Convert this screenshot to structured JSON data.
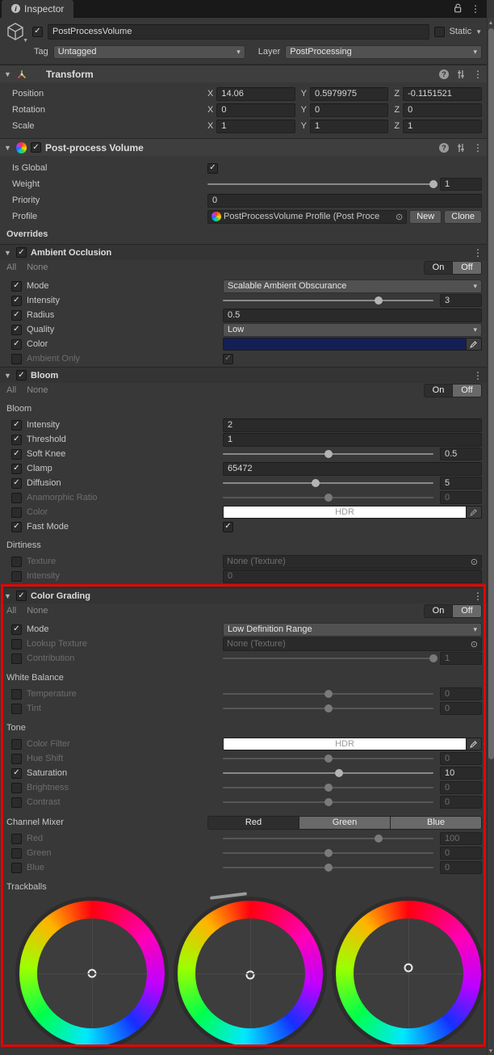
{
  "icons": {
    "check": "✓",
    "foldout": "▼",
    "caret": "▾",
    "kebab": "⋮",
    "help": "?",
    "picker": "⊙",
    "up": "▲",
    "down": "▼",
    "info": "i",
    "static_caret": "▼"
  },
  "colors": {
    "highlight": "#e60000",
    "ao_color_swatch": "#141f56"
  },
  "tab": {
    "title": "Inspector"
  },
  "gameobject": {
    "name": "PostProcessVolume",
    "static_label": "Static",
    "tag_label": "Tag",
    "tag_value": "Untagged",
    "layer_label": "Layer",
    "layer_value": "PostProcessing"
  },
  "transform": {
    "title": "Transform",
    "axis": {
      "x": "X",
      "y": "Y",
      "z": "Z"
    },
    "position": {
      "label": "Position",
      "x": "14.06",
      "y": "0.5979975",
      "z": "-0.1151521"
    },
    "rotation": {
      "label": "Rotation",
      "x": "0",
      "y": "0",
      "z": "0"
    },
    "scale": {
      "label": "Scale",
      "x": "1",
      "y": "1",
      "z": "1"
    }
  },
  "volume": {
    "title": "Post-process Volume",
    "is_global_label": "Is Global",
    "weight_label": "Weight",
    "weight_value": "1",
    "priority_label": "Priority",
    "priority_value": "0",
    "profile_label": "Profile",
    "profile_value": "PostProcessVolume Profile (Post Proce",
    "new_label": "New",
    "clone_label": "Clone",
    "overrides_label": "Overrides"
  },
  "shared": {
    "all": "All",
    "none": "None",
    "on": "On",
    "off": "Off",
    "hdr": "HDR"
  },
  "ambient_occlusion": {
    "title": "Ambient Occlusion",
    "mode_label": "Mode",
    "mode_value": "Scalable Ambient Obscurance",
    "intensity_label": "Intensity",
    "intensity_value": "3",
    "radius_label": "Radius",
    "radius_value": "0.5",
    "quality_label": "Quality",
    "quality_value": "Low",
    "color_label": "Color",
    "ambient_only_label": "Ambient Only"
  },
  "bloom": {
    "title": "Bloom",
    "group_label": "Bloom",
    "intensity_label": "Intensity",
    "intensity_value": "2",
    "threshold_label": "Threshold",
    "threshold_value": "1",
    "soft_knee_label": "Soft Knee",
    "soft_knee_value": "0.5",
    "clamp_label": "Clamp",
    "clamp_value": "65472",
    "diffusion_label": "Diffusion",
    "diffusion_value": "5",
    "anamorphic_label": "Anamorphic Ratio",
    "anamorphic_value": "0",
    "color_label": "Color",
    "fast_mode_label": "Fast Mode",
    "dirtiness_label": "Dirtiness",
    "texture_label": "Texture",
    "texture_value": "None (Texture)",
    "dirt_intensity_label": "Intensity",
    "dirt_intensity_value": "0"
  },
  "color_grading": {
    "title": "Color Grading",
    "mode_label": "Mode",
    "mode_value": "Low Definition Range",
    "lookup_label": "Lookup Texture",
    "lookup_value": "None (Texture)",
    "contribution_label": "Contribution",
    "contribution_value": "1",
    "white_balance_label": "White Balance",
    "temperature_label": "Temperature",
    "temperature_value": "0",
    "tint_label": "Tint",
    "tint_value": "0",
    "tone_label": "Tone",
    "color_filter_label": "Color Filter",
    "hue_shift_label": "Hue Shift",
    "hue_shift_value": "0",
    "saturation_label": "Saturation",
    "saturation_value": "10",
    "brightness_label": "Brightness",
    "brightness_value": "0",
    "contrast_label": "Contrast",
    "contrast_value": "0",
    "channel_mixer_label": "Channel Mixer",
    "channel_red_tab": "Red",
    "channel_green_tab": "Green",
    "channel_blue_tab": "Blue",
    "red_label": "Red",
    "red_value": "100",
    "green_label": "Green",
    "green_value": "0",
    "blue_label": "Blue",
    "blue_value": "0",
    "trackballs_label": "Trackballs"
  }
}
